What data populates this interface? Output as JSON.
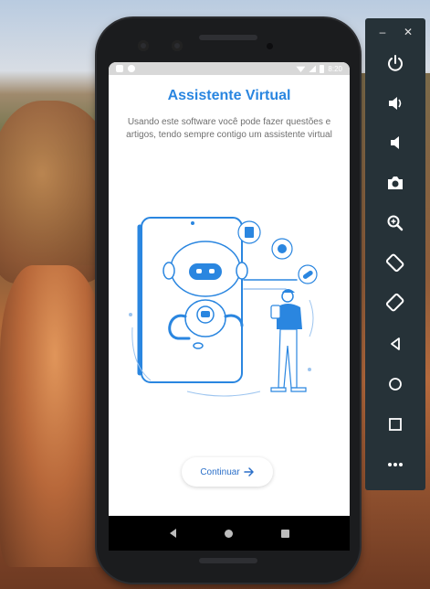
{
  "app": {
    "title": "Assistente Virtual",
    "subtitle": "Usando este software você pode fazer questões e artigos, tendo sempre contigo um assistente virtual",
    "continue_label": "Continuar",
    "accent_color": "#2a86e0"
  },
  "statusbar": {
    "time": "8:20"
  },
  "navbar": {
    "back_icon": "back-triangle-icon",
    "home_icon": "home-circle-icon",
    "recent_icon": "recent-square-icon"
  },
  "emulator_panel": {
    "minimize_label": "–",
    "close_label": "✕",
    "buttons": [
      "power-icon",
      "volume-up-icon",
      "volume-down-icon",
      "camera-icon",
      "zoom-in-icon",
      "rotate-left-icon",
      "rotate-right-icon",
      "back-icon",
      "home-icon",
      "overview-icon",
      "more-icon"
    ]
  }
}
